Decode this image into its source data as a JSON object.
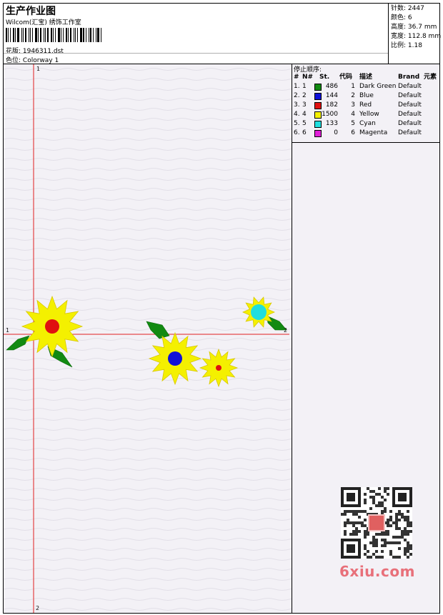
{
  "header": {
    "title": "生产作业图",
    "company": "Wilcom(汇宝) 绣饰工作室",
    "design_label": "花版:",
    "design_value": "1946311.dst",
    "colorway_label": "色位:",
    "colorway_value": "Colorway 1"
  },
  "stats": {
    "stitches_label": "针数:",
    "stitches_value": "2447",
    "colors_label": "颜色:",
    "colors_value": "6",
    "height_label": "高度:",
    "height_value": "36.7 mm",
    "width_label": "宽度:",
    "width_value": "112.8 mm",
    "scale_label": "比例:",
    "scale_value": "1.18"
  },
  "canvas": {
    "axis_top": "1",
    "axis_bottom": "2",
    "axis_left": "1",
    "axis_right": "2",
    "crosshair_color": "#e02020"
  },
  "sequence": {
    "heading": "停止顺序:",
    "columns": [
      "#",
      "N#",
      "St.",
      "代码",
      "描述",
      "Brand",
      "元素"
    ],
    "rows": [
      {
        "no": "1.",
        "n": "1",
        "color": "#128a12",
        "st": "486",
        "code": "1",
        "desc": "Dark Green",
        "brand": "Default"
      },
      {
        "no": "2.",
        "n": "2",
        "color": "#1010d8",
        "st": "144",
        "code": "2",
        "desc": "Blue",
        "brand": "Default"
      },
      {
        "no": "3.",
        "n": "3",
        "color": "#e01010",
        "st": "182",
        "code": "3",
        "desc": "Red",
        "brand": "Default"
      },
      {
        "no": "4.",
        "n": "4",
        "color": "#f4f000",
        "st": "1500",
        "code": "4",
        "desc": "Yellow",
        "brand": "Default"
      },
      {
        "no": "5.",
        "n": "5",
        "color": "#20dede",
        "st": "133",
        "code": "5",
        "desc": "Cyan",
        "brand": "Default"
      },
      {
        "no": "6.",
        "n": "6",
        "color": "#e020d8",
        "st": "0",
        "code": "6",
        "desc": "Magenta",
        "brand": "Default"
      }
    ]
  },
  "watermark": "6xiu.com"
}
